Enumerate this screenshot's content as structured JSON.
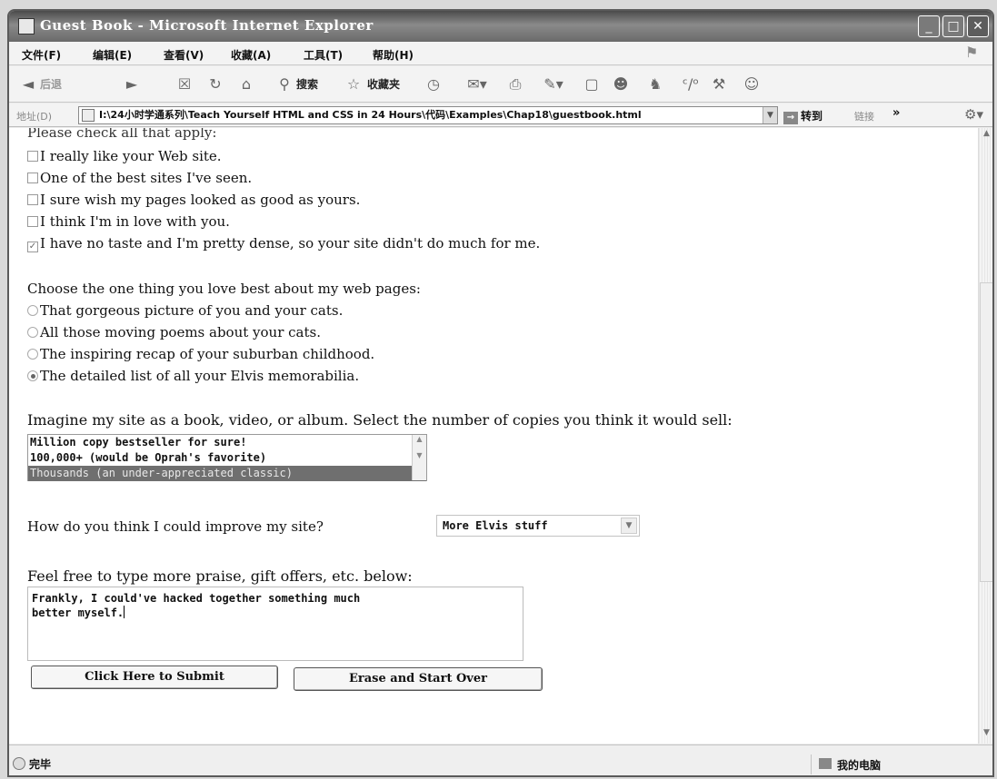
{
  "window": {
    "title": "Guest Book - Microsoft Internet Explorer",
    "controls": {
      "minimize": "_",
      "maximize": "□",
      "close": "✕"
    }
  },
  "menu": [
    {
      "label": "文件(F)"
    },
    {
      "label": "编辑(E)"
    },
    {
      "label": "查看(V)"
    },
    {
      "label": "收藏(A)"
    },
    {
      "label": "工具(T)"
    },
    {
      "label": "帮助(H)"
    }
  ],
  "toolbar": {
    "back_label": "后退",
    "search_label": "搜索",
    "favorites_label": "收藏夹",
    "icons": [
      "back-icon",
      "forward-icon",
      "stop-icon",
      "refresh-icon",
      "home-icon",
      "search-icon",
      "favorites-icon",
      "history-icon",
      "mail-icon",
      "print-icon",
      "edit-icon",
      "discuss-icon",
      "messenger-icon",
      "research-icon",
      "translate-icon"
    ]
  },
  "address": {
    "label": "地址(D)",
    "url": "I:\\24小时学通系列\\Teach Yourself HTML and CSS in 24 Hours\\代码\\Examples\\Chap18\\guestbook.html",
    "go_label": "转到",
    "links_label": "链接",
    "more": "»"
  },
  "form": {
    "check_prompt": "Please check all that apply:",
    "checkboxes": [
      {
        "label": "I really like your Web site.",
        "checked": false
      },
      {
        "label": "One of the best sites I've seen.",
        "checked": false
      },
      {
        "label": "I sure wish my pages looked as good as yours.",
        "checked": false
      },
      {
        "label": "I think I'm in love with you.",
        "checked": false
      },
      {
        "label": "I have no taste and I'm pretty dense, so your site didn't do much for me.",
        "checked": true
      }
    ],
    "radio_prompt": "Choose the one thing you love best about my web pages:",
    "radios": [
      {
        "label": "That gorgeous picture of you and your cats.",
        "selected": false
      },
      {
        "label": "All those moving poems about your cats.",
        "selected": false
      },
      {
        "label": "The inspiring recap of your suburban childhood.",
        "selected": false
      },
      {
        "label": "The detailed list of all your Elvis memorabilia.",
        "selected": true
      }
    ],
    "list_prompt": "Imagine my site as a book, video, or album. Select the number of copies you think it would sell:",
    "list_options": [
      {
        "label": "Million copy bestseller for sure!",
        "selected": false
      },
      {
        "label": "100,000+ (would be Oprah's favorite)",
        "selected": false
      },
      {
        "label": "Thousands (an under-appreciated classic)",
        "selected": true
      }
    ],
    "improve_prompt": "How do you think I could improve my site?",
    "improve_value": "More Elvis stuff",
    "comments_prompt": "Feel free to type more praise, gift offers, etc. below:",
    "comments_value": "Frankly, I could've hacked together something much\nbetter myself.",
    "submit_label": "Click Here to Submit",
    "reset_label": "Erase and Start Over"
  },
  "status": {
    "text": "完毕",
    "zone": "我的电脑"
  },
  "colors": {
    "title_bar": "#6a6a6a",
    "list_selection": "#6f6f6f",
    "page_background": "#ffffff"
  }
}
